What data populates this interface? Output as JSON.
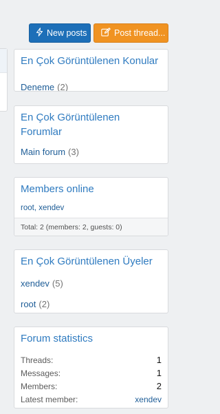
{
  "buttons": {
    "new_posts": "New posts",
    "post_thread": "Post thread..."
  },
  "most_viewed_threads": {
    "title": "En Çok Görüntülenen Konular",
    "items": [
      {
        "label": "Deneme",
        "count": "(2)"
      }
    ]
  },
  "most_viewed_forums": {
    "title_line1": "En Çok Görüntülenen",
    "title_line2": "Forumlar",
    "items": [
      {
        "label": "Main forum",
        "count": "(3)"
      }
    ]
  },
  "members_online": {
    "title": "Members online",
    "members": "root, xendev",
    "footer": "Total: 2 (members: 2, guests: 0)"
  },
  "most_viewed_members": {
    "title": "En Çok Görüntülenen Üyeler",
    "items": [
      {
        "label": "xendev",
        "count": "(5)"
      },
      {
        "label": "root",
        "count": "(2)"
      }
    ]
  },
  "forum_statistics": {
    "title": "Forum statistics",
    "rows": [
      {
        "label": "Threads:",
        "value": "1"
      },
      {
        "label": "Messages:",
        "value": "1"
      },
      {
        "label": "Members:",
        "value": "2"
      },
      {
        "label": "Latest member:",
        "value": "xendev"
      }
    ]
  },
  "colors": {
    "primary_button": "#1d6fb8",
    "accent_button": "#f09322",
    "title": "#2f7bc0",
    "link": "#1e5d97"
  },
  "icons": {
    "new_posts": "bolt-icon",
    "post_thread": "edit-icon"
  }
}
